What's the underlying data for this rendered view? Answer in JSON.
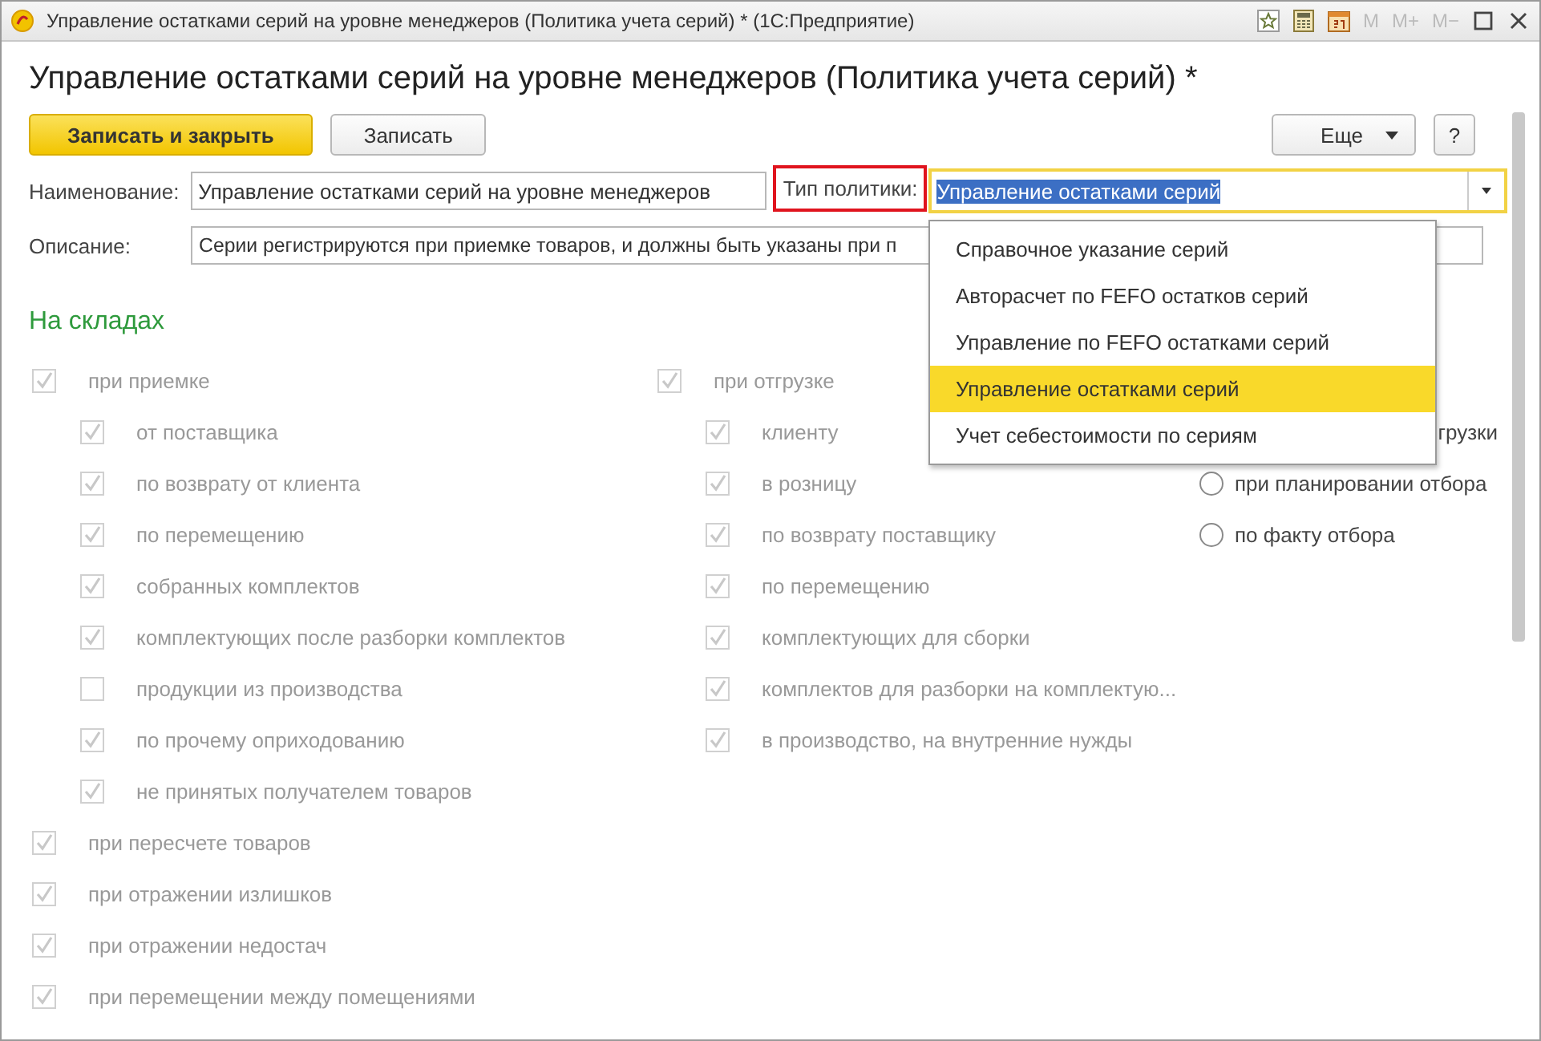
{
  "window": {
    "title": "Управление остатками серий на уровне менеджеров (Политика учета серий) * (1С:Предприятие)",
    "memory_buttons": [
      "M",
      "M+",
      "M−"
    ]
  },
  "form_title": "Управление остатками серий на уровне менеджеров (Политика учета серий) *",
  "toolbar": {
    "buttons": [
      {
        "label": "Записать и закрыть",
        "kind": "primary"
      },
      {
        "label": "Записать",
        "kind": "default"
      }
    ],
    "more": "Еще",
    "help": "?"
  },
  "name_field": {
    "label": "Наименование:",
    "value": "Управление остатками серий на уровне менеджеров"
  },
  "policy_field": {
    "label": "Тип политики:",
    "value": "Управление остатками серий",
    "highlighted": true,
    "focused": true
  },
  "description_field": {
    "label": "Описание:",
    "value": "Серии регистрируются при приемке товаров, и должны быть указаны при п"
  },
  "dropdown": {
    "items": [
      {
        "label": "Справочное указание серий",
        "selected": false
      },
      {
        "label": "Авторасчет по FEFO остатков серий",
        "selected": false
      },
      {
        "label": "Управление по FEFO остатками серий",
        "selected": false
      },
      {
        "label": "Управление остатками серий",
        "selected": true
      },
      {
        "label": "Учет себестоимости по сериям",
        "selected": false
      }
    ]
  },
  "section_title": "На складах",
  "left_column": [
    {
      "label": "при приемке",
      "checked": true,
      "children": [
        {
          "label": "от поставщика",
          "checked": true
        },
        {
          "label": "по возврату от клиента",
          "checked": true
        },
        {
          "label": "по перемещению",
          "checked": true
        },
        {
          "label": "собранных комплектов",
          "checked": true
        },
        {
          "label": "комплектующих после разборки комплектов",
          "checked": true
        },
        {
          "label": "продукции из производства",
          "checked": false
        },
        {
          "label": "по прочему оприходованию",
          "checked": true
        },
        {
          "label": "не принятых получателем товаров",
          "checked": true
        }
      ]
    },
    {
      "label": "при пересчете товаров",
      "checked": true
    },
    {
      "label": "при отражении излишков",
      "checked": true
    },
    {
      "label": "при отражении недостач",
      "checked": true
    },
    {
      "label": "при перемещении между помещениями",
      "checked": true
    }
  ],
  "middle_column": [
    {
      "label": "при отгрузке",
      "checked": true,
      "children": [
        {
          "label": "клиенту",
          "checked": true
        },
        {
          "label": "в розницу",
          "checked": true
        },
        {
          "label": "по возврату поставщику",
          "checked": true
        },
        {
          "label": "по перемещению",
          "checked": true
        },
        {
          "label": "комплектующих для сборки",
          "checked": true
        },
        {
          "label": "комплектов для разборки на комплектую...",
          "checked": true
        },
        {
          "label": "в производство, на внутренние нужды",
          "checked": true
        }
      ]
    }
  ],
  "radio_options": [
    {
      "label": "грузки",
      "kind": "partial"
    },
    {
      "label": "при планировании отбора",
      "kind": "radio",
      "selected": false
    },
    {
      "label": "по факту отбора",
      "kind": "radio",
      "selected": false
    }
  ]
}
